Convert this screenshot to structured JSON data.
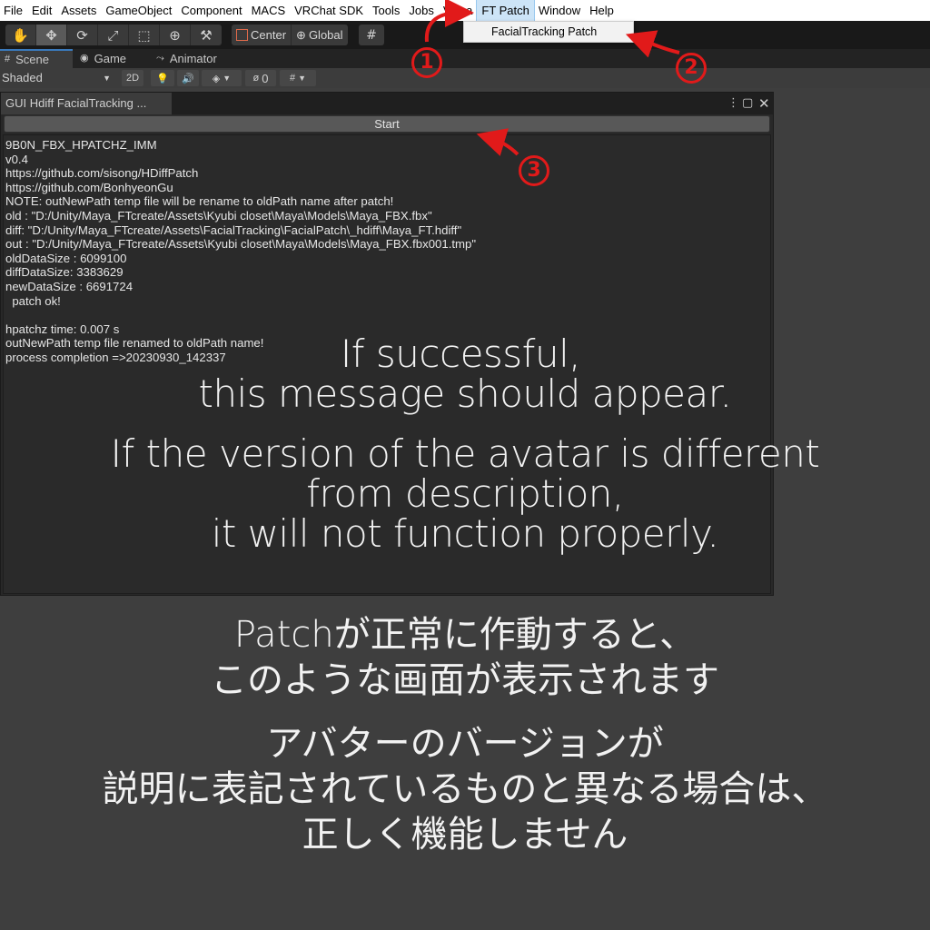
{
  "menubar": {
    "items": [
      "File",
      "Edit",
      "Assets",
      "GameObject",
      "Component",
      "MACS",
      "VRChat SDK",
      "Tools",
      "Jobs",
      "VRLa",
      "FT Patch",
      "Window",
      "Help"
    ],
    "active": "FT Patch"
  },
  "dropdown": {
    "item": "FacialTracking Patch"
  },
  "toolbar": {
    "center_label": "Center",
    "global_label": "Global"
  },
  "tabs": {
    "scene": "Scene",
    "game": "Game",
    "animator": "Animator"
  },
  "scenebar": {
    "shaded": "Shaded",
    "mode_2d": "2D",
    "hidden_count": "0"
  },
  "window": {
    "title": "GUI Hdiff FacialTracking ...",
    "start_label": "Start",
    "log": [
      "9B0N_FBX_HPATCHZ_IMM",
      "v0.4",
      "https://github.com/sisong/HDiffPatch",
      "https://github.com/BonhyeonGu",
      "NOTE: outNewPath temp file will be rename to oldPath name after patch!",
      "old : \"D:/Unity/Maya_FTcreate/Assets\\Kyubi closet\\Maya\\Models\\Maya_FBX.fbx\"",
      "diff: \"D:/Unity/Maya_FTcreate/Assets\\FacialTracking\\FacialPatch\\_hdiff\\Maya_FT.hdiff\"",
      "out : \"D:/Unity/Maya_FTcreate/Assets\\Kyubi closet\\Maya\\Models\\Maya_FBX.fbx001.tmp\"",
      "oldDataSize : 6099100",
      "diffDataSize: 3383629",
      "newDataSize : 6691724",
      "  patch ok!",
      "",
      "hpatchz time: 0.007 s",
      "outNewPath temp file renamed to oldPath name!",
      "process completion =>20230930_142337"
    ]
  },
  "overlay_en": {
    "line1": "If successful,",
    "line2": "this message should appear.",
    "line3": "If the version of the avatar is different",
    "line4": "from description,",
    "line5": "it will not function properly."
  },
  "overlay_jp": {
    "line1": "Patchが正常に作動すると、",
    "line2": "このような画面が表示されます",
    "line3": "アバターのバージョンが",
    "line4": "説明に表記されているものと異なる場合は、",
    "line5": "正しく機能しません"
  },
  "annotations": {
    "step1": "1",
    "step2": "2",
    "step3": "3",
    "color": "#e11a1a"
  }
}
